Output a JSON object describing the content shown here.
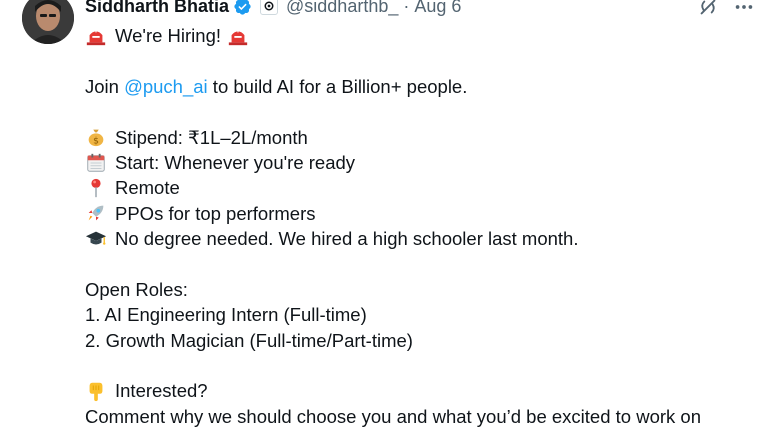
{
  "author": {
    "display_name": "Siddharth Bhatia",
    "handle": "@siddharthb_",
    "separator": "·",
    "date": "Aug 6",
    "verified": true
  },
  "icons": {
    "verified": "verified-badge-icon",
    "affiliate": "affiliate-badge-icon",
    "grok": "grok-icon",
    "more": "more-icon",
    "siren": "police-light-icon",
    "money": "money-bag-icon",
    "calendar": "calendar-icon",
    "pin": "round-pushpin-icon",
    "rocket": "rocket-icon",
    "grad": "graduation-cap-icon",
    "point_down": "backhand-index-pointing-down-icon"
  },
  "colors": {
    "link": "#1d9bf0",
    "verified": "#1d9bf0",
    "muted": "#536471",
    "text": "#0f1419"
  },
  "post": {
    "headline": "We're Hiring!",
    "intro_before": "Join ",
    "intro_mention": "@puch_ai",
    "intro_after": " to build AI for a Billion+ people.",
    "perks": [
      "Stipend: ₹1L–2L/month",
      "Start: Whenever you're ready",
      "Remote",
      "PPOs for top performers",
      "No degree needed. We hired a high schooler last month."
    ],
    "roles_heading": "Open Roles:",
    "roles": [
      "1. AI Engineering Intern (Full-time)",
      "2. Growth Magician (Full-time/Part-time)"
    ],
    "interested": "Interested?",
    "comment_line": "Comment why we should choose you and what you’d be excited to work on"
  }
}
